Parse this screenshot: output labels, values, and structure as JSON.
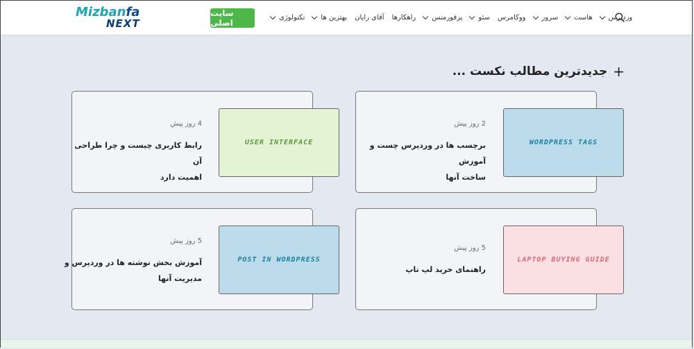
{
  "header": {
    "logo_top_a": "Mizban",
    "logo_top_b": "fa",
    "logo_bottom": "NEXT",
    "main_site_button": "سایت اصلی",
    "nav": [
      {
        "label": "وردپرس",
        "dropdown": true
      },
      {
        "label": "هاست",
        "dropdown": true
      },
      {
        "label": "سرور",
        "dropdown": true
      },
      {
        "label": "ووکامرس",
        "dropdown": false
      },
      {
        "label": "سئو",
        "dropdown": true
      },
      {
        "label": "پرفورمنس",
        "dropdown": true
      },
      {
        "label": "راهکارها",
        "dropdown": false
      },
      {
        "label": "آقای رایان",
        "dropdown": false
      },
      {
        "label": "بهترین ها",
        "dropdown": true
      },
      {
        "label": "تکنولوژی",
        "dropdown": true
      }
    ]
  },
  "section": {
    "plus": "+",
    "title": "جدیدترین مطالب نکست ..."
  },
  "posts": [
    {
      "thumb": "WordPress Tags",
      "thumb_bg": "#bcdcec",
      "thumb_color": "#1a7fa0",
      "date": "2 روز پیش",
      "title_line1": "برچسب ها در وردپرس چست و آموزش",
      "title_line2": "ساخت آنها"
    },
    {
      "thumb": "User Interface",
      "thumb_bg": "#e4f3d4",
      "thumb_color": "#5b9a3a",
      "date": "4 روز پیش",
      "title_line1": "رابط کاربری چیست و چرا طراحی آن",
      "title_line2": "اهمیت دارد"
    },
    {
      "thumb": "Laptop Buying Guide",
      "thumb_bg": "#fbe0e3",
      "thumb_color": "#d86a78",
      "date": "5 روز پیش",
      "title_line1": "راهنمای خرید لپ تاپ",
      "title_line2": ""
    },
    {
      "thumb": "Post in WordPress",
      "thumb_bg": "#bcdcec",
      "thumb_color": "#1a7fa0",
      "date": "5 روز پیش",
      "title_line1": "آموزش بخش نوشته ها در وردپرس و",
      "title_line2": "مدیریت آنها"
    }
  ]
}
